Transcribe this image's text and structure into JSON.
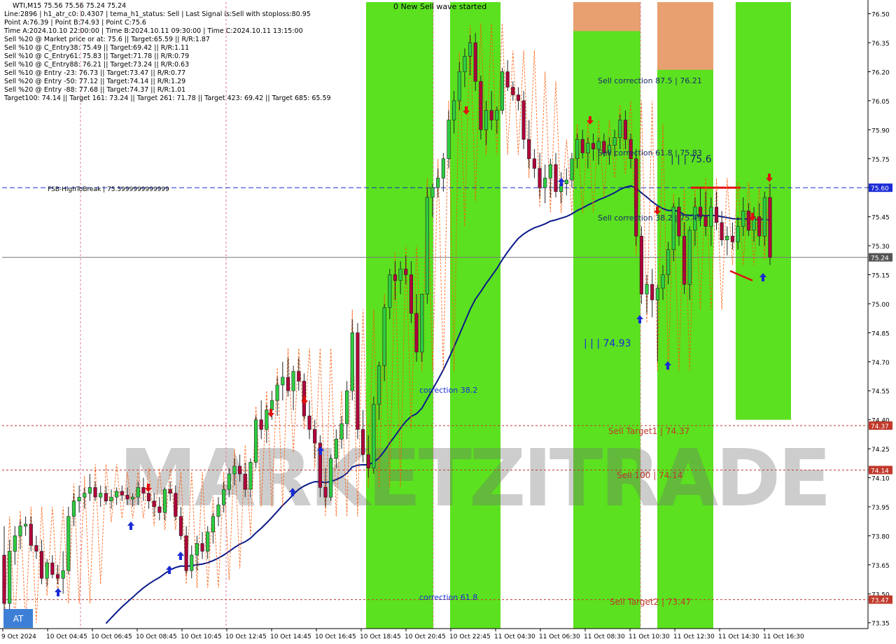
{
  "header": {
    "symbol_line": "WTI,M15  75.56 75.56 75.24 75.24",
    "info_lines": [
      "Line:2896 | h1_atr_c0: 0.4307 | tema_h1_status: Sell | Last Signal is:Sell with stoploss:80.95",
      "Point A:76.39 | Point B:74.93 | Point C:75.6",
      "Time A:2024.10.10 22:00:00 | Time B:2024.10.11 09:30:00 | Time C:2024.10.11 13:15:00",
      "Sell %20 @ Market price or at: 75.6 || Target:65.59 || R/R:1.87",
      "Sell %10 @ C_Entry38: 75.49 || Target:69.42 || R/R:1.11",
      "Sell %10 @ C_Entry61: 75.83 || Target:71.78 || R/R:0.79",
      "Sell %10 @ C_Entry88: 76.21 || Target:73.24 || R/R:0.63",
      "Sell %10 @ Entry -23: 76.73 || Target:73.47 || R/R:0.77",
      "Sell %20 @ Entry -50: 77.12 || Target:74.14 || R/R:1.29",
      "Sell %20 @ Entry -88: 77.68 || Target:74.37 || R/R:1.01",
      "Target100: 74.14 || Target 161: 73.24 || Target 261: 71.78 || Target 423: 69.42 || Target 685: 65.59"
    ]
  },
  "colors": {
    "bull": "#2ecc40",
    "bear": "#b0003a",
    "zone_green": "#44dd00",
    "zone_orange": "#e8a070",
    "ma_line": "#0a1a8a",
    "level_red": "#c0392b",
    "fsb_blue": "#1a2bd6",
    "price_gray": "#777777"
  },
  "labels": {
    "top_notice": "0 New Sell wave started",
    "fsb": "FSB-HighToBreak | 75.5999999999999",
    "sell_corr_875": "Sell correction 87.5 | 76.21",
    "sell_corr_618": "Sell correction 61.8 | 75.83",
    "sell_corr_382": "Sell correction 38.2 | 75.49",
    "point_c": "| | | 75.6",
    "point_b": "| | | 74.93",
    "correction_382": "correction 38.2",
    "correction_618": "correction 61.8",
    "sell_target1": "Sell Target1 | 74.37",
    "sell_100": "Sell 100 | 74.14",
    "sell_target2": "Sell Target2 | 73.47",
    "watermark": "MARKETZITRADE",
    "at_button": "AT"
  },
  "price_axis": {
    "ticks": [
      "76.50",
      "76.35",
      "76.20",
      "76.05",
      "75.90",
      "75.75",
      "75.60",
      "75.45",
      "75.30",
      "75.15",
      "75.00",
      "74.85",
      "74.70",
      "74.55",
      "74.40",
      "74.25",
      "74.10",
      "73.95",
      "73.80",
      "73.65",
      "73.50",
      "73.35"
    ],
    "tags": [
      {
        "value": "75.60",
        "color": "#1a2bd6"
      },
      {
        "value": "75.24",
        "color": "#555555"
      },
      {
        "value": "74.37",
        "color": "#c0392b"
      },
      {
        "value": "74.14",
        "color": "#c0392b"
      },
      {
        "value": "73.47",
        "color": "#c0392b"
      }
    ]
  },
  "time_axis": {
    "labels": [
      "9 Oct 2024",
      "10 Oct 04:45",
      "10 Oct 06:45",
      "10 Oct 08:45",
      "10 Oct 10:45",
      "10 Oct 12:45",
      "10 Oct 14:45",
      "10 Oct 16:45",
      "10 Oct 18:45",
      "10 Oct 20:45",
      "10 Oct 22:45",
      "11 Oct 04:30",
      "11 Oct 06:30",
      "11 Oct 08:30",
      "11 Oct 10:30",
      "11 Oct 12:30",
      "11 Oct 14:30",
      "11 Oct 16:30"
    ]
  },
  "chart_data": {
    "type": "candlestick",
    "title": "WTI,M15",
    "price_range": [
      73.32,
      76.56
    ],
    "levels": {
      "fsb_high_to_break": 75.6,
      "current_price": 75.24,
      "sell_target1": 74.37,
      "sell_100": 74.14,
      "sell_target2": 73.47
    },
    "candles": [
      [
        73.7,
        73.85,
        73.4,
        73.45
      ],
      [
        73.45,
        73.78,
        73.42,
        73.72
      ],
      [
        73.72,
        73.85,
        73.65,
        73.8
      ],
      [
        73.8,
        73.88,
        73.73,
        73.85
      ],
      [
        73.85,
        73.9,
        73.8,
        73.86
      ],
      [
        73.86,
        73.9,
        73.72,
        73.75
      ],
      [
        73.75,
        73.8,
        73.68,
        73.72
      ],
      [
        73.72,
        73.78,
        73.55,
        73.58
      ],
      [
        73.58,
        73.68,
        73.54,
        73.66
      ],
      [
        73.66,
        73.7,
        73.58,
        73.6
      ],
      [
        73.6,
        73.65,
        73.55,
        73.58
      ],
      [
        73.58,
        73.72,
        73.5,
        73.62
      ],
      [
        73.62,
        73.95,
        73.6,
        73.9
      ],
      [
        73.9,
        74.02,
        73.85,
        73.98
      ],
      [
        73.98,
        74.06,
        73.92,
        74.0
      ],
      [
        74.0,
        74.05,
        73.94,
        74.02
      ],
      [
        74.02,
        74.12,
        73.98,
        74.05
      ],
      [
        74.05,
        74.08,
        73.98,
        74.0
      ],
      [
        74.0,
        74.06,
        73.95,
        74.02
      ],
      [
        74.02,
        74.06,
        73.96,
        73.98
      ],
      [
        73.98,
        74.04,
        73.94,
        74.0
      ],
      [
        74.0,
        74.05,
        73.96,
        74.03
      ],
      [
        74.03,
        74.06,
        73.98,
        74.01
      ],
      [
        74.01,
        74.05,
        73.96,
        73.99
      ],
      [
        73.99,
        74.02,
        73.95,
        74.0
      ],
      [
        74.0,
        74.08,
        73.96,
        74.05
      ],
      [
        74.05,
        74.1,
        73.98,
        74.02
      ],
      [
        74.02,
        74.06,
        73.94,
        73.98
      ],
      [
        73.98,
        74.02,
        73.9,
        73.95
      ],
      [
        73.95,
        74.0,
        73.88,
        73.92
      ],
      [
        73.92,
        74.05,
        73.88,
        74.04
      ],
      [
        74.04,
        74.08,
        73.98,
        74.02
      ],
      [
        74.02,
        74.06,
        73.88,
        73.9
      ],
      [
        73.9,
        73.95,
        73.78,
        73.8
      ],
      [
        73.8,
        73.85,
        73.6,
        73.62
      ],
      [
        73.62,
        73.75,
        73.58,
        73.7
      ],
      [
        73.7,
        73.8,
        73.62,
        73.76
      ],
      [
        73.76,
        73.82,
        73.68,
        73.72
      ],
      [
        73.72,
        73.85,
        73.68,
        73.82
      ],
      [
        73.82,
        73.92,
        73.76,
        73.9
      ],
      [
        73.9,
        74.0,
        73.85,
        73.96
      ],
      [
        73.96,
        74.08,
        73.92,
        74.04
      ],
      [
        74.04,
        74.15,
        74.0,
        74.12
      ],
      [
        74.12,
        74.2,
        74.06,
        74.16
      ],
      [
        74.16,
        74.22,
        74.08,
        74.12
      ],
      [
        74.12,
        74.18,
        74.0,
        74.04
      ],
      [
        74.04,
        74.2,
        74.0,
        74.18
      ],
      [
        74.18,
        74.42,
        74.15,
        74.4
      ],
      [
        74.4,
        74.5,
        74.3,
        74.35
      ],
      [
        74.35,
        74.48,
        74.28,
        74.45
      ],
      [
        74.45,
        74.55,
        74.4,
        74.5
      ],
      [
        74.5,
        74.62,
        74.42,
        74.58
      ],
      [
        74.58,
        74.7,
        74.5,
        74.62
      ],
      [
        74.62,
        74.72,
        74.52,
        74.55
      ],
      [
        74.55,
        74.68,
        74.45,
        74.65
      ],
      [
        74.65,
        74.72,
        74.55,
        74.6
      ],
      [
        74.6,
        74.64,
        74.4,
        74.42
      ],
      [
        74.42,
        74.5,
        74.3,
        74.35
      ],
      [
        74.35,
        74.4,
        74.2,
        74.28
      ],
      [
        74.28,
        74.32,
        74.0,
        74.05
      ],
      [
        74.05,
        74.15,
        73.95,
        74.0
      ],
      [
        74.0,
        74.22,
        73.98,
        74.2
      ],
      [
        74.2,
        74.35,
        74.15,
        74.3
      ],
      [
        74.3,
        74.42,
        74.25,
        74.38
      ],
      [
        74.38,
        74.6,
        74.3,
        74.55
      ],
      [
        74.55,
        74.92,
        74.5,
        74.85
      ],
      [
        74.85,
        74.9,
        74.3,
        74.35
      ],
      [
        74.35,
        74.45,
        74.18,
        74.22
      ],
      [
        74.22,
        74.32,
        74.1,
        74.15
      ],
      [
        74.15,
        74.52,
        74.12,
        74.48
      ],
      [
        74.48,
        74.7,
        74.4,
        74.68
      ],
      [
        74.68,
        75.0,
        74.6,
        74.98
      ],
      [
        74.98,
        75.18,
        74.92,
        75.15
      ],
      [
        75.15,
        75.22,
        75.02,
        75.12
      ],
      [
        75.12,
        75.22,
        75.05,
        75.18
      ],
      [
        75.18,
        75.25,
        75.1,
        75.15
      ],
      [
        75.15,
        75.22,
        74.9,
        74.95
      ],
      [
        74.95,
        75.05,
        74.7,
        74.75
      ],
      [
        74.75,
        75.05,
        74.7,
        75.05
      ],
      [
        75.05,
        75.6,
        75.0,
        75.55
      ],
      [
        75.55,
        75.62,
        75.45,
        75.6
      ],
      [
        75.6,
        75.7,
        75.55,
        75.65
      ],
      [
        75.65,
        75.78,
        75.58,
        75.75
      ],
      [
        75.75,
        76.0,
        75.7,
        75.95
      ],
      [
        75.95,
        76.1,
        75.88,
        76.05
      ],
      [
        76.05,
        76.25,
        76.0,
        76.2
      ],
      [
        76.2,
        76.32,
        76.12,
        76.28
      ],
      [
        76.28,
        76.39,
        76.18,
        76.35
      ],
      [
        76.35,
        76.4,
        76.1,
        76.15
      ],
      [
        76.15,
        76.18,
        75.85,
        75.9
      ],
      [
        75.9,
        76.05,
        75.82,
        76.0
      ],
      [
        76.0,
        76.1,
        75.9,
        75.95
      ],
      [
        75.95,
        76.02,
        75.88,
        76.0
      ],
      [
        76.0,
        76.22,
        75.98,
        76.2
      ],
      [
        76.2,
        76.26,
        76.1,
        76.12
      ],
      [
        76.12,
        76.15,
        76.05,
        76.08
      ],
      [
        76.08,
        76.12,
        76.0,
        76.05
      ],
      [
        76.05,
        76.1,
        75.8,
        75.85
      ],
      [
        75.85,
        75.95,
        75.7,
        75.75
      ],
      [
        75.75,
        75.8,
        75.65,
        75.7
      ],
      [
        75.7,
        75.78,
        75.55,
        75.6
      ],
      [
        75.6,
        75.72,
        75.52,
        75.65
      ],
      [
        75.65,
        75.75,
        75.55,
        75.72
      ],
      [
        75.72,
        75.78,
        75.55,
        75.58
      ],
      [
        75.58,
        75.68,
        75.52,
        75.62
      ],
      [
        75.62,
        75.7,
        75.56,
        75.64
      ],
      [
        75.64,
        75.78,
        75.6,
        75.75
      ],
      [
        75.75,
        75.88,
        75.7,
        75.85
      ],
      [
        75.85,
        75.9,
        75.75,
        75.78
      ],
      [
        75.78,
        75.86,
        75.7,
        75.83
      ],
      [
        75.83,
        75.88,
        75.74,
        75.8
      ],
      [
        75.8,
        75.86,
        75.72,
        75.84
      ],
      [
        75.84,
        75.88,
        75.76,
        75.78
      ],
      [
        75.78,
        75.86,
        75.72,
        75.82
      ],
      [
        75.82,
        75.9,
        75.76,
        75.86
      ],
      [
        75.86,
        75.98,
        75.8,
        75.95
      ],
      [
        75.95,
        76.0,
        75.8,
        75.85
      ],
      [
        75.85,
        75.88,
        75.7,
        75.75
      ],
      [
        75.75,
        75.8,
        75.3,
        75.35
      ],
      [
        75.35,
        75.4,
        75.0,
        75.05
      ],
      [
        75.05,
        75.15,
        74.95,
        75.1
      ],
      [
        75.1,
        75.18,
        74.93,
        75.02
      ],
      [
        75.02,
        75.1,
        74.7,
        75.08
      ],
      [
        75.08,
        75.2,
        75.02,
        75.15
      ],
      [
        75.15,
        75.32,
        75.1,
        75.28
      ],
      [
        75.28,
        75.52,
        75.22,
        75.5
      ],
      [
        75.5,
        75.55,
        75.3,
        75.35
      ],
      [
        75.35,
        75.42,
        75.05,
        75.1
      ],
      [
        75.1,
        75.4,
        75.02,
        75.38
      ],
      [
        75.38,
        75.55,
        75.3,
        75.5
      ],
      [
        75.5,
        75.6,
        75.4,
        75.45
      ],
      [
        75.45,
        75.58,
        75.35,
        75.4
      ],
      [
        75.4,
        75.55,
        75.3,
        75.5
      ],
      [
        75.5,
        75.58,
        75.38,
        75.42
      ],
      [
        75.42,
        75.48,
        75.3,
        75.33
      ],
      [
        75.33,
        75.4,
        75.25,
        75.35
      ],
      [
        75.35,
        75.42,
        75.28,
        75.32
      ],
      [
        75.32,
        75.45,
        75.28,
        75.4
      ],
      [
        75.4,
        75.55,
        75.35,
        75.48
      ],
      [
        75.48,
        75.52,
        75.35,
        75.38
      ],
      [
        75.38,
        75.5,
        75.32,
        75.45
      ],
      [
        75.45,
        75.52,
        75.3,
        75.35
      ],
      [
        75.35,
        75.58,
        75.3,
        75.55
      ],
      [
        75.55,
        75.62,
        75.2,
        75.24
      ]
    ]
  }
}
